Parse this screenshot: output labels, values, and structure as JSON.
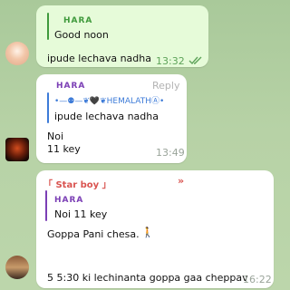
{
  "colors": {
    "chat_bg": "#b3d0a3",
    "out_bubble": "#e6fbd9",
    "in_bubble": "#ffffff",
    "out_accent": "#3f9a3c",
    "in_accent": "#7b3fb5",
    "starboy_accent": "#d9534f",
    "reply_blue": "#3d7bd8"
  },
  "messages": [
    {
      "direction": "outgoing",
      "reply": {
        "sender": "HARA",
        "text": "Good noon"
      },
      "text": "ipude lechava nadha",
      "time": "13:32",
      "status_icon": "double-check-icon"
    },
    {
      "direction": "incoming",
      "sender": "HARA",
      "reply_action": "Reply",
      "reply": {
        "sender": "•—⚉—❦🖤❦HEMALATHⒶ•",
        "text": "ipude lechava nadha"
      },
      "lines": [
        "Noi",
        "11 key"
      ],
      "time": "13:49"
    },
    {
      "direction": "incoming",
      "sender": "「 Star boy 」",
      "sender_suffix": "»",
      "reply": {
        "sender": "HARA",
        "text": "Noi  11 key"
      },
      "text": "Goppa Pani chesa.",
      "emoji": "🚶",
      "text2": "5 5:30 ki lechinanta goppa gaa cheppav",
      "time": "16:22"
    }
  ]
}
